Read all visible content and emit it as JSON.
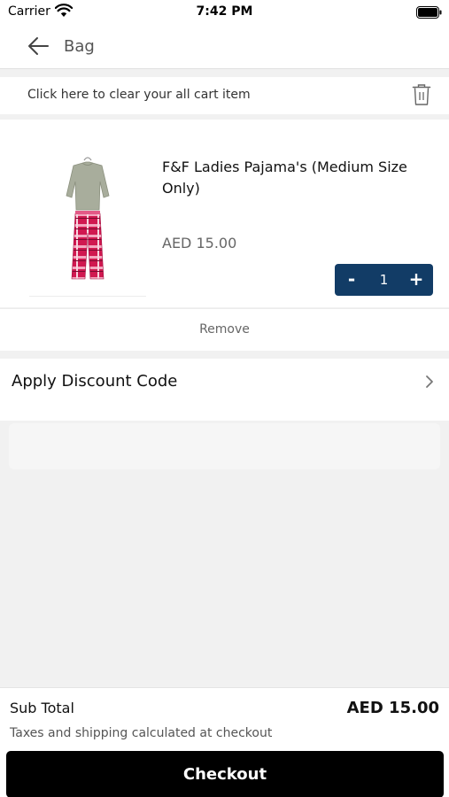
{
  "status_bar": {
    "carrier": "Carrier",
    "time": "7:42 PM"
  },
  "nav": {
    "title": "Bag",
    "back_icon": "back-arrow-icon"
  },
  "cart_header": {
    "clear_text": "Click here to clear your all cart item",
    "trash_icon": "trash-icon"
  },
  "item": {
    "name": "F&F Ladies Pajama's (Medium Size Only)",
    "price": "AED 15.00",
    "quantity": "1",
    "minus_label": "-",
    "plus_label": "+",
    "remove_label": "Remove"
  },
  "discount": {
    "label": "Apply Discount Code",
    "chevron_icon": "chevron-right-icon"
  },
  "summary": {
    "subtotal_label": "Sub Total",
    "subtotal_value": "AED 15.00",
    "taxes_note": "Taxes and shipping calculated at checkout",
    "checkout_label": "Checkout"
  },
  "colors": {
    "stepper_bg": "#123c66",
    "checkout_bg": "#000000",
    "page_bg": "#f1f1f1"
  }
}
